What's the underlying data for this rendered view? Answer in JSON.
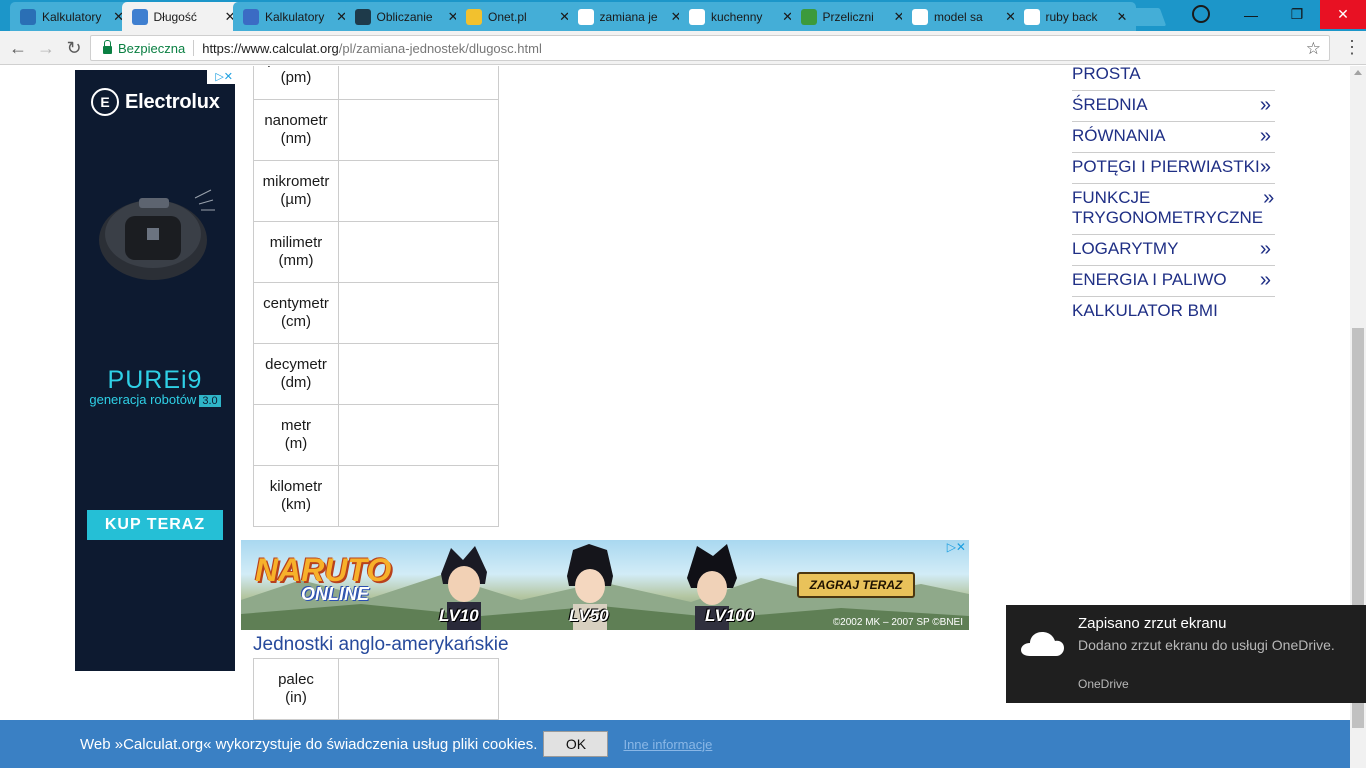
{
  "browser": {
    "tabs": [
      {
        "label": "Kalkulatory",
        "favicon_color": "#2a6fb5",
        "active": false
      },
      {
        "label": "Długość",
        "favicon_color": "#3f7fd0",
        "active": true
      },
      {
        "label": "Kalkulatory",
        "favicon_color": "#3b6bc4",
        "active": false
      },
      {
        "label": "Obliczanie",
        "favicon_color": "#1e3a4a",
        "active": false
      },
      {
        "label": "Onet.pl",
        "favicon_color": "#f2c12e",
        "active": false
      },
      {
        "label": "zamiana je",
        "favicon_color": "#ffffff",
        "active": false
      },
      {
        "label": "kuchenny",
        "favicon_color": "#ffffff",
        "active": false
      },
      {
        "label": "Przeliczni",
        "favicon_color": "#3c9a3c",
        "active": false
      },
      {
        "label": "model sa",
        "favicon_color": "#ffffff",
        "active": false
      },
      {
        "label": "ruby back",
        "favicon_color": "#ffffff",
        "active": false
      }
    ],
    "tab_close": "✕",
    "security_label": "Bezpieczna",
    "url_host": "https://www.calculat.org",
    "url_path": "/pl/zamiana-jednostek/dlugosc.html",
    "star_icon": "☆",
    "menu_icon": "⋮",
    "back_icon": "←",
    "forward_icon": "→",
    "reload_icon": "↻",
    "minimize_icon": "—",
    "restore_icon": "❐",
    "close_icon": "✕"
  },
  "ad_left": {
    "brand": "Electrolux",
    "product": "PUREi9",
    "subtitle": "generacja robotów",
    "version": "3.0",
    "cta": "KUP TERAZ",
    "adchoice": "▷✕"
  },
  "units_metric": [
    {
      "name": "pikometr",
      "abbr": "(pm)"
    },
    {
      "name": "nanometr",
      "abbr": "(nm)"
    },
    {
      "name": "mikrometr",
      "abbr": "(µm)"
    },
    {
      "name": "milimetr",
      "abbr": "(mm)"
    },
    {
      "name": "centymetr",
      "abbr": "(cm)"
    },
    {
      "name": "decymetr",
      "abbr": "(dm)"
    },
    {
      "name": "metr",
      "abbr": "(m)"
    },
    {
      "name": "kilometr",
      "abbr": "(km)"
    }
  ],
  "ad_mid": {
    "title": "NARUTO",
    "subtitle": "ONLINE",
    "levels": [
      "LV10",
      "LV50",
      "LV100"
    ],
    "cta": "ZAGRAJ TERAZ",
    "copyright": "©2002 MK – 2007 SP   ©BNEI",
    "adchoice": "▷✕"
  },
  "section_heading": "Jednostki anglo-amerykańskie",
  "units_imperial": [
    {
      "name": "palec",
      "abbr": "(in)"
    }
  ],
  "right_menu": [
    {
      "label": "PROSTA",
      "arrow": ""
    },
    {
      "label": "ŚREDNIA",
      "arrow": "»"
    },
    {
      "label": "RÓWNANIA",
      "arrow": "»"
    },
    {
      "label": "POTĘGI I PIERWIASTKI",
      "arrow": "»"
    },
    {
      "label": "FUNKCJE TRYGONOMETRYCZNE",
      "arrow": "»"
    },
    {
      "label": "LOGARYTMY",
      "arrow": "»"
    },
    {
      "label": "ENERGIA I PALIWO",
      "arrow": "»"
    },
    {
      "label": "KALKULATOR BMI",
      "arrow": ""
    }
  ],
  "toast": {
    "title": "Zapisano zrzut ekranu",
    "message": "Dodano zrzut ekranu do usługi OneDrive.",
    "app": "OneDrive"
  },
  "cookie": {
    "text": "Web »Calculat.org« wykorzystuje do świadczenia usług pliki cookies.",
    "ok": "OK",
    "more": "Inne informacje"
  }
}
